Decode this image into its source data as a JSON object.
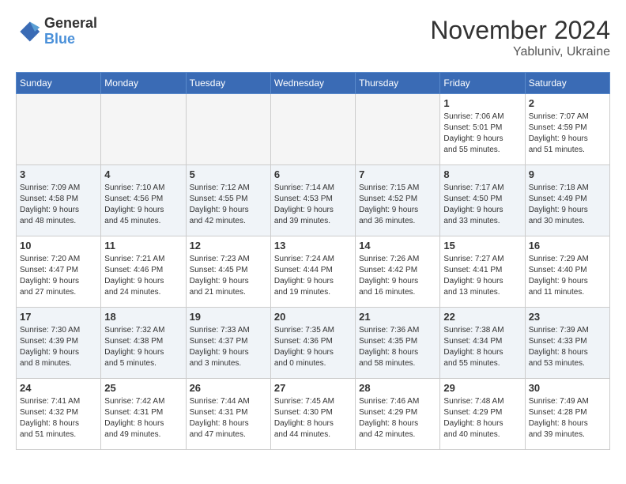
{
  "logo": {
    "general": "General",
    "blue": "Blue"
  },
  "header": {
    "month": "November 2024",
    "location": "Yabluniv, Ukraine"
  },
  "weekdays": [
    "Sunday",
    "Monday",
    "Tuesday",
    "Wednesday",
    "Thursday",
    "Friday",
    "Saturday"
  ],
  "weeks": [
    [
      {
        "day": "",
        "info": ""
      },
      {
        "day": "",
        "info": ""
      },
      {
        "day": "",
        "info": ""
      },
      {
        "day": "",
        "info": ""
      },
      {
        "day": "",
        "info": ""
      },
      {
        "day": "1",
        "info": "Sunrise: 7:06 AM\nSunset: 5:01 PM\nDaylight: 9 hours\nand 55 minutes."
      },
      {
        "day": "2",
        "info": "Sunrise: 7:07 AM\nSunset: 4:59 PM\nDaylight: 9 hours\nand 51 minutes."
      }
    ],
    [
      {
        "day": "3",
        "info": "Sunrise: 7:09 AM\nSunset: 4:58 PM\nDaylight: 9 hours\nand 48 minutes."
      },
      {
        "day": "4",
        "info": "Sunrise: 7:10 AM\nSunset: 4:56 PM\nDaylight: 9 hours\nand 45 minutes."
      },
      {
        "day": "5",
        "info": "Sunrise: 7:12 AM\nSunset: 4:55 PM\nDaylight: 9 hours\nand 42 minutes."
      },
      {
        "day": "6",
        "info": "Sunrise: 7:14 AM\nSunset: 4:53 PM\nDaylight: 9 hours\nand 39 minutes."
      },
      {
        "day": "7",
        "info": "Sunrise: 7:15 AM\nSunset: 4:52 PM\nDaylight: 9 hours\nand 36 minutes."
      },
      {
        "day": "8",
        "info": "Sunrise: 7:17 AM\nSunset: 4:50 PM\nDaylight: 9 hours\nand 33 minutes."
      },
      {
        "day": "9",
        "info": "Sunrise: 7:18 AM\nSunset: 4:49 PM\nDaylight: 9 hours\nand 30 minutes."
      }
    ],
    [
      {
        "day": "10",
        "info": "Sunrise: 7:20 AM\nSunset: 4:47 PM\nDaylight: 9 hours\nand 27 minutes."
      },
      {
        "day": "11",
        "info": "Sunrise: 7:21 AM\nSunset: 4:46 PM\nDaylight: 9 hours\nand 24 minutes."
      },
      {
        "day": "12",
        "info": "Sunrise: 7:23 AM\nSunset: 4:45 PM\nDaylight: 9 hours\nand 21 minutes."
      },
      {
        "day": "13",
        "info": "Sunrise: 7:24 AM\nSunset: 4:44 PM\nDaylight: 9 hours\nand 19 minutes."
      },
      {
        "day": "14",
        "info": "Sunrise: 7:26 AM\nSunset: 4:42 PM\nDaylight: 9 hours\nand 16 minutes."
      },
      {
        "day": "15",
        "info": "Sunrise: 7:27 AM\nSunset: 4:41 PM\nDaylight: 9 hours\nand 13 minutes."
      },
      {
        "day": "16",
        "info": "Sunrise: 7:29 AM\nSunset: 4:40 PM\nDaylight: 9 hours\nand 11 minutes."
      }
    ],
    [
      {
        "day": "17",
        "info": "Sunrise: 7:30 AM\nSunset: 4:39 PM\nDaylight: 9 hours\nand 8 minutes."
      },
      {
        "day": "18",
        "info": "Sunrise: 7:32 AM\nSunset: 4:38 PM\nDaylight: 9 hours\nand 5 minutes."
      },
      {
        "day": "19",
        "info": "Sunrise: 7:33 AM\nSunset: 4:37 PM\nDaylight: 9 hours\nand 3 minutes."
      },
      {
        "day": "20",
        "info": "Sunrise: 7:35 AM\nSunset: 4:36 PM\nDaylight: 9 hours\nand 0 minutes."
      },
      {
        "day": "21",
        "info": "Sunrise: 7:36 AM\nSunset: 4:35 PM\nDaylight: 8 hours\nand 58 minutes."
      },
      {
        "day": "22",
        "info": "Sunrise: 7:38 AM\nSunset: 4:34 PM\nDaylight: 8 hours\nand 55 minutes."
      },
      {
        "day": "23",
        "info": "Sunrise: 7:39 AM\nSunset: 4:33 PM\nDaylight: 8 hours\nand 53 minutes."
      }
    ],
    [
      {
        "day": "24",
        "info": "Sunrise: 7:41 AM\nSunset: 4:32 PM\nDaylight: 8 hours\nand 51 minutes."
      },
      {
        "day": "25",
        "info": "Sunrise: 7:42 AM\nSunset: 4:31 PM\nDaylight: 8 hours\nand 49 minutes."
      },
      {
        "day": "26",
        "info": "Sunrise: 7:44 AM\nSunset: 4:31 PM\nDaylight: 8 hours\nand 47 minutes."
      },
      {
        "day": "27",
        "info": "Sunrise: 7:45 AM\nSunset: 4:30 PM\nDaylight: 8 hours\nand 44 minutes."
      },
      {
        "day": "28",
        "info": "Sunrise: 7:46 AM\nSunset: 4:29 PM\nDaylight: 8 hours\nand 42 minutes."
      },
      {
        "day": "29",
        "info": "Sunrise: 7:48 AM\nSunset: 4:29 PM\nDaylight: 8 hours\nand 40 minutes."
      },
      {
        "day": "30",
        "info": "Sunrise: 7:49 AM\nSunset: 4:28 PM\nDaylight: 8 hours\nand 39 minutes."
      }
    ]
  ]
}
